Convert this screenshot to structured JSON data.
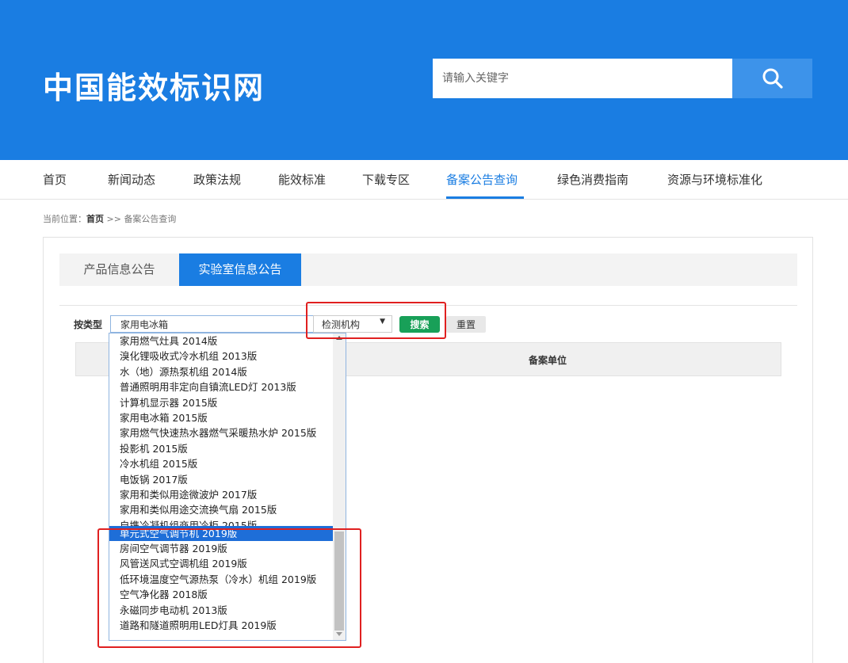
{
  "header": {
    "logo": "中国能效标识网",
    "search_placeholder": "请输入关键字"
  },
  "nav": [
    "首页",
    "新闻动态",
    "政策法规",
    "能效标准",
    "下载专区",
    "备案公告查询",
    "绿色消费指南",
    "资源与环境标准化"
  ],
  "nav_active_index": 5,
  "breadcrumb": {
    "prefix": "当前位置：",
    "home": "首页",
    "sep": " >> ",
    "current": "备案公告查询"
  },
  "tabs": [
    "产品信息公告",
    "实验室信息公告"
  ],
  "filter": {
    "label": "按类型",
    "type_value": "家用电冰箱",
    "org_value": "检测机构",
    "search_label": "搜索",
    "reset_label": "重置"
  },
  "table": {
    "col_unit": "备案单位"
  },
  "dropdown": {
    "options": [
      "家用燃气灶具 2014版",
      "溴化锂吸收式冷水机组 2013版",
      "水（地）源热泵机组 2014版",
      "普通照明用非定向自镇流LED灯 2013版",
      "计算机显示器 2015版",
      "家用电冰箱 2015版",
      "家用燃气快速热水器燃气采暖热水炉 2015版",
      "投影机 2015版",
      "冷水机组 2015版",
      "电饭锅 2017版",
      "家用和类似用途微波炉 2017版",
      "家用和类似用途交流换气扇 2015版",
      "自携冷凝机组商用冷柜 2015版",
      "单元式空气调节机 2019版",
      "房间空气调节器 2019版",
      "风管送风式空调机组 2019版",
      "低环境温度空气源热泵（冷水）机组 2019版",
      "空气净化器 2018版",
      "永磁同步电动机 2013版",
      "道路和隧道照明用LED灯具 2019版"
    ],
    "selected_index": 13
  },
  "colors": {
    "brand_blue": "#1a7de2",
    "search_green": "#18a058",
    "highlight_red": "#e02020"
  }
}
